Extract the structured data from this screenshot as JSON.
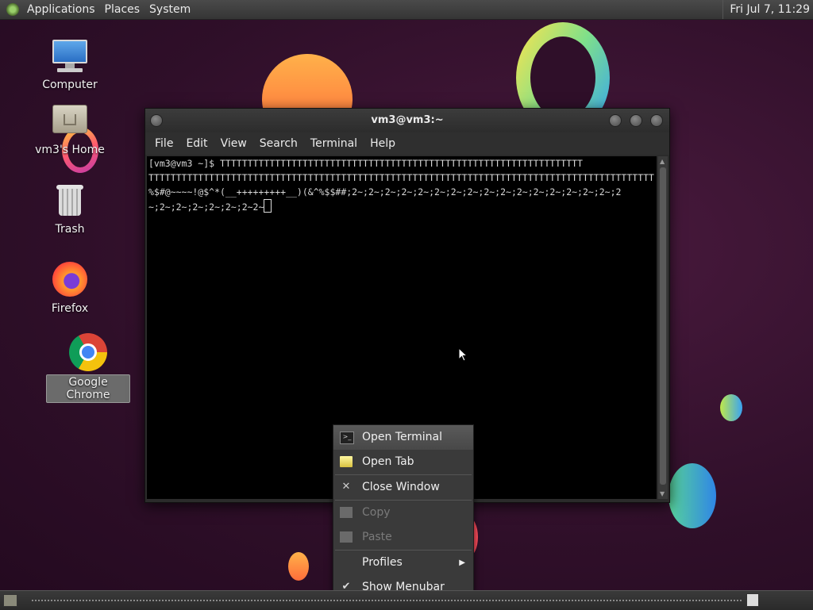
{
  "top_panel": {
    "menus": [
      "Applications",
      "Places",
      "System"
    ],
    "clock": "Fri Jul  7, 11:29"
  },
  "desktop_icons": [
    {
      "label": "Computer",
      "icon": "computer-icon"
    },
    {
      "label": "vm3's Home",
      "icon": "home-folder-icon"
    },
    {
      "label": "Trash",
      "icon": "trash-icon"
    },
    {
      "label": "Firefox",
      "icon": "firefox-icon"
    },
    {
      "label": "Google Chrome",
      "icon": "chrome-icon",
      "selected": true
    }
  ],
  "terminal": {
    "title": "vm3@vm3:~",
    "menus": [
      "File",
      "Edit",
      "View",
      "Search",
      "Terminal",
      "Help"
    ],
    "lines": [
      "[vm3@vm3 ~]$ TTTTTTTTTTTTTTTTTTTTTTTTTTTTTTTTTTTTTTTTTTTTTTTTTTTTTTTTTTTTTTTTTT",
      "TTTTTTTTTTTTTTTTTTTTTTTTTTTTTTTTTTTTTTTTTTTTTTTTTTTTTTTTTTTTTTTTTTTTTTTTTTTTTTTTTTTTTTTTTTTT",
      "%$#@~~~~!@$^*(__+++++++++__)(&^%$$##;2~;2~;2~;2~;2~;2~;2~;2~;2~;2~;2~;2~;2~;2~;2~;2~;2",
      "~;2~;2~;2~;2~;2~;2~2~"
    ]
  },
  "context_menu": {
    "items": [
      {
        "label": "Open Terminal",
        "icon": "terminal-icon",
        "state": "hover"
      },
      {
        "label": "Open Tab",
        "icon": "new-tab-icon",
        "state": "normal"
      },
      {
        "label": "Close Window",
        "icon": "close-icon",
        "state": "normal"
      },
      {
        "label": "Copy",
        "icon": "copy-icon",
        "state": "disabled"
      },
      {
        "label": "Paste",
        "icon": "paste-icon",
        "state": "disabled"
      },
      {
        "label": "Profiles",
        "icon": "",
        "state": "submenu"
      },
      {
        "label": "Show Menubar",
        "icon": "check-icon",
        "state": "checked"
      }
    ]
  },
  "colors": {
    "desktop_bg": "#2f0f29",
    "terminal_bg": "#000000",
    "panel_bg": "#3a3a3a"
  }
}
